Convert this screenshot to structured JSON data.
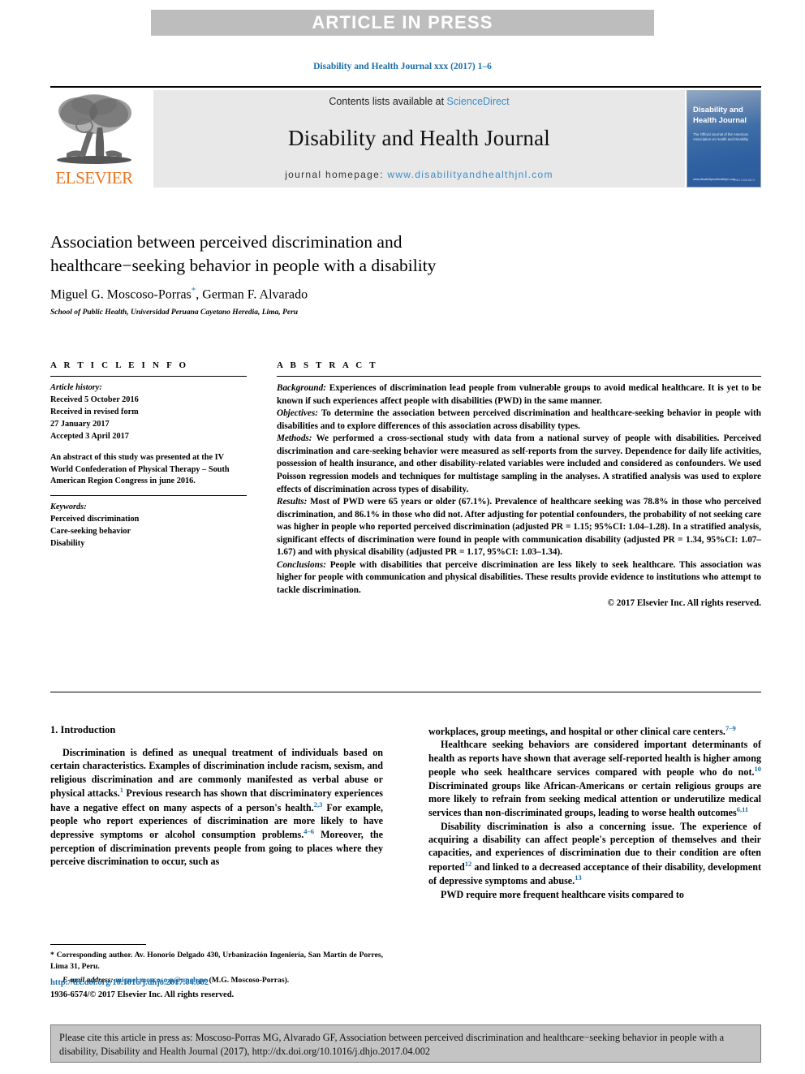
{
  "banner": {
    "text": "ARTICLE IN PRESS"
  },
  "running_head": "Disability and Health Journal xxx (2017) 1–6",
  "masthead": {
    "publisher": "ELSEVIER",
    "contents_prefix": "Contents lists available at ",
    "contents_link": "ScienceDirect",
    "journal_title": "Disability and Health Journal",
    "homepage_prefix": "journal homepage: ",
    "homepage_url": "www.disabilityandhealthjnl.com",
    "cover": {
      "title_line1": "Disability and",
      "title_line2": "Health Journal",
      "subtitle": "The Official Journal of the American Association on Health and Disability",
      "footer_left": "www.disabilityandhealthjnl.com",
      "footer_right": "ISSN 1936-6574"
    }
  },
  "article": {
    "title_line1": "Association between perceived discrimination and",
    "title_line2": "healthcare−seeking behavior in people with a disability",
    "authors": "Miguel G. Moscoso-Porras",
    "authors_rest": ", German F. Alvarado",
    "corresponding_mark": "*",
    "affiliation": "School of Public Health, Universidad Peruana Cayetano Heredia, Lima, Peru"
  },
  "article_info": {
    "heading": "A R T I C L E    I N F O",
    "history_label": "Article history:",
    "history": [
      "Received 5 October 2016",
      "Received in revised form",
      "27 January 2017",
      "Accepted 3 April 2017"
    ],
    "note": "An abstract of this study was presented at the IV World Confederation of Physical Therapy – South American Region Congress in june 2016.",
    "keywords_label": "Keywords:",
    "keywords": [
      "Perceived discrimination",
      "Care-seeking behavior",
      "Disability"
    ]
  },
  "abstract": {
    "heading": "A B S T R A C T",
    "sections": [
      {
        "label": "Background:",
        "text": " Experiences of discrimination lead people from vulnerable groups to avoid medical healthcare. It is yet to be known if such experiences affect people with disabilities (PWD) in the same manner."
      },
      {
        "label": "Objectives:",
        "text": " To determine the association between perceived discrimination and healthcare-seeking behavior in people with disabilities and to explore differences of this association across disability types."
      },
      {
        "label": "Methods:",
        "text": " We performed a cross-sectional study with data from a national survey of people with disabilities. Perceived discrimination and care-seeking behavior were measured as self-reports from the survey. Dependence for daily life activities, possession of health insurance, and other disability-related variables were included and considered as confounders. We used Poisson regression models and techniques for multistage sampling in the analyses. A stratified analysis was used to explore effects of discrimination across types of disability."
      },
      {
        "label": "Results:",
        "text": "  Most of PWD were 65 years or older (67.1%). Prevalence of healthcare seeking was 78.8% in those who perceived discrimination, and 86.1% in those who did not. After adjusting for potential confounders, the probability of not seeking care was higher in people who reported perceived discrimination (adjusted PR = 1.15; 95%CI: 1.04–1.28). In a stratified analysis, significant effects of discrimination were found in people with communication disability (adjusted PR = 1.34, 95%CI: 1.07–1.67) and with physical disability (adjusted PR = 1.17, 95%CI: 1.03–1.34)."
      },
      {
        "label": "Conclusions:",
        "text": " People with disabilities that perceive discrimination are less likely to seek healthcare. This association was higher for people with communication and physical disabilities. These results provide evidence to institutions who attempt to tackle discrimination."
      }
    ],
    "copyright": "© 2017 Elsevier Inc. All rights reserved."
  },
  "introduction": {
    "heading": "1. Introduction",
    "left_paragraphs": [
      "Discrimination is defined as unequal treatment of individuals based on certain characteristics. Examples of discrimination include racism, sexism, and religious discrimination and are commonly manifested as verbal abuse or physical attacks.",
      "Previous research has shown that discriminatory experiences have a negative effect on many aspects of a person's health.",
      "For example, people who report experiences of discrimination are more likely to have depressive symptoms or alcohol consumption problems.",
      "Moreover, the perception of discrimination prevents people from going to places where they perceive discrimination to occur, such as"
    ],
    "left_refs": [
      "1",
      "2,3",
      "4–6"
    ],
    "right_paragraphs": [
      "workplaces, group meetings, and hospital or other clinical care centers.",
      "Healthcare seeking behaviors are considered important determinants of health as reports have shown that average self-reported health is higher among people who seek healthcare services compared with people who do not.",
      "Discriminated groups like African-Americans or certain religious groups are more likely to refrain from seeking medical attention or underutilize medical services than non-discriminated groups, leading to worse health outcomes",
      "Disability discrimination is also a concerning issue. The experience of acquiring a disability can affect people's perception of themselves and their capacities, and experiences of discrimination due to their condition are often reported",
      "and linked to a decreased acceptance of their disability, development of depressive symptoms and abuse.",
      "PWD require more frequent healthcare visits compared to"
    ],
    "right_refs": [
      "7–9",
      "10",
      "6,11",
      "12",
      "13"
    ]
  },
  "footnote": {
    "mark": "*",
    "corresponding": " Corresponding author. Av. Honorio Delgado 430, Urbanización Ingeniería, San Martin de Porres, Lima 31, Peru.",
    "email_label": "E-mail address:",
    "email": "miguel.moscoso.p@upch.pe",
    "email_suffix": " (M.G. Moscoso-Porras)."
  },
  "footer": {
    "doi": "http://dx.doi.org/10.1016/j.dhjo.2017.04.002",
    "issn": "1936-6574/© 2017 Elsevier Inc. All rights reserved."
  },
  "cite_box": {
    "text": "Please cite this article in press as: Moscoso-Porras MG, Alvarado GF, Association between perceived discrimination and healthcare−seeking behavior in people with a disability, Disability and Health Journal (2017), http://dx.doi.org/10.1016/j.dhjo.2017.04.002"
  }
}
